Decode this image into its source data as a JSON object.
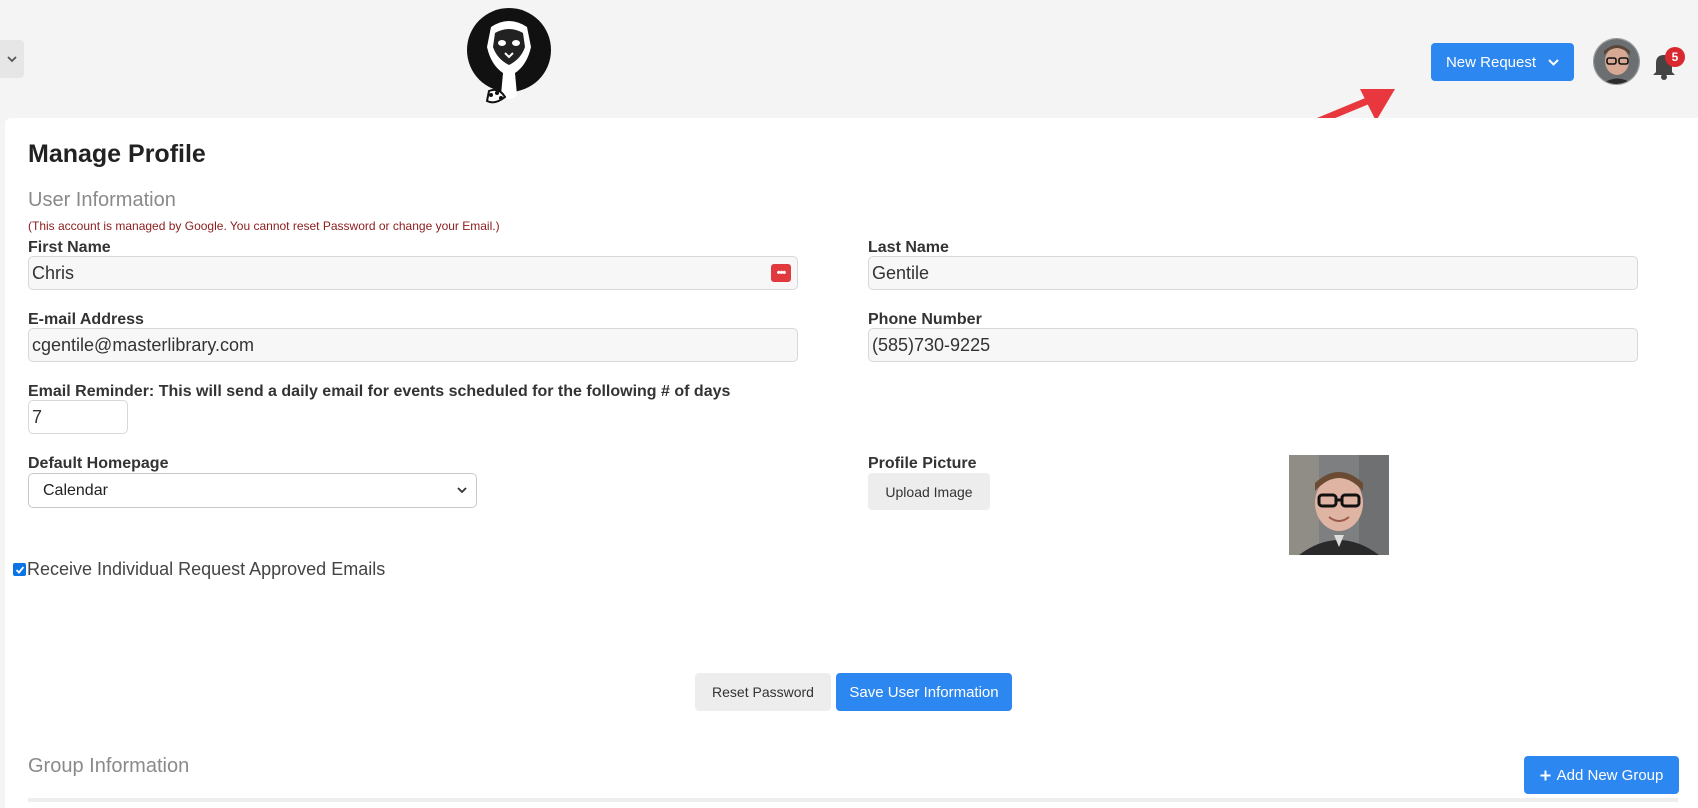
{
  "header": {
    "new_request_label": "New Request",
    "notification_count": "5"
  },
  "page": {
    "title": "Manage Profile",
    "user_section_title": "User Information",
    "notice": "(This account is managed by Google. You cannot reset Password or change your Email.)",
    "group_section_title": "Group Information"
  },
  "form": {
    "first_name": {
      "label": "First Name",
      "value": "Chris"
    },
    "last_name": {
      "label": "Last Name",
      "value": "Gentile"
    },
    "email": {
      "label": "E-mail Address",
      "value": "cgentile@masterlibrary.com"
    },
    "phone": {
      "label": "Phone Number",
      "value": "(585)730-9225"
    },
    "reminder": {
      "label": "Email Reminder: This will send a daily email for events scheduled for the following # of days",
      "value": "7"
    },
    "homepage": {
      "label": "Default Homepage",
      "value": "Calendar"
    },
    "profile_picture": {
      "label": "Profile Picture",
      "upload_label": "Upload Image"
    },
    "approved_emails": {
      "label": "Receive Individual Request Approved Emails",
      "checked": true
    }
  },
  "actions": {
    "reset_password": "Reset Password",
    "save": "Save User Information",
    "add_group": "Add New Group"
  },
  "colors": {
    "primary": "#2d87f0",
    "badge": "#d9282f",
    "notice": "#8b1c1c",
    "annotation_arrow": "#e8373d"
  }
}
